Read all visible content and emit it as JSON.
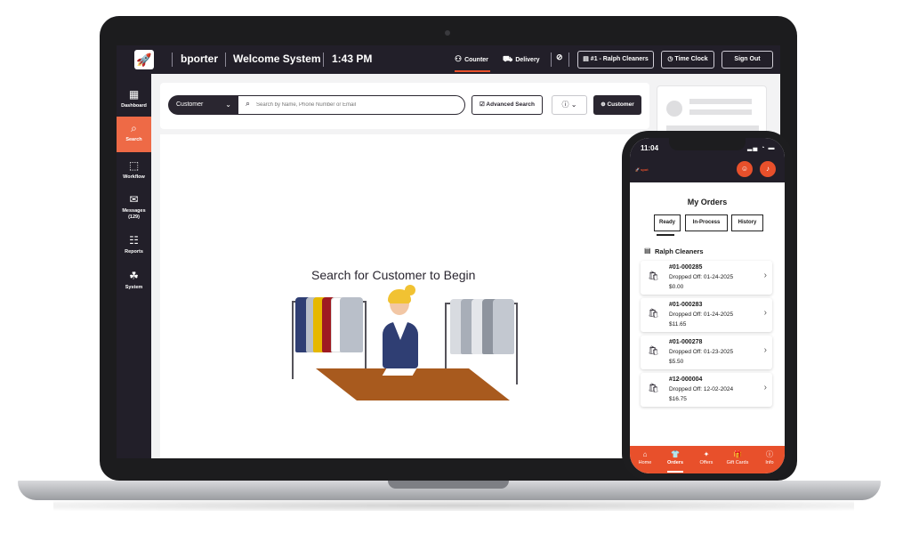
{
  "topbar": {
    "username": "bporter",
    "system_title": "Welcome System",
    "time": "1:43 PM",
    "nav": [
      {
        "label": "Counter",
        "icon": "people-icon"
      },
      {
        "label": "Delivery",
        "icon": "truck-icon"
      }
    ],
    "store_button": "#1 - Ralph Cleaners",
    "time_clock_button": "Time Clock",
    "sign_out_button": "Sign Out",
    "accent_color": "#e8502b"
  },
  "sidebar": {
    "items": [
      {
        "label": "Dashboard",
        "icon": "dashboard-icon"
      },
      {
        "label": "Search",
        "icon": "search-icon",
        "active": true
      },
      {
        "label": "Workflow",
        "icon": "workflow-icon"
      },
      {
        "label": "Messages",
        "sub": "(129)",
        "icon": "messages-icon"
      },
      {
        "label": "Reports",
        "icon": "reports-icon"
      },
      {
        "label": "System",
        "icon": "system-icon"
      }
    ]
  },
  "search": {
    "filter_value": "Customer",
    "placeholder": "Search by Name, Phone Number or Email",
    "advanced_button": "Advanced Search",
    "customer_button": "Customer"
  },
  "main": {
    "heading": "Search for Customer to Begin"
  },
  "phone": {
    "time": "11:04",
    "title": "My Orders",
    "tabs": [
      "Ready",
      "In-Process",
      "History"
    ],
    "store_name": "Ralph Cleaners",
    "orders": [
      {
        "number": "#01-000285",
        "dropped": "Dropped Off: 01-24-2025",
        "amount": "$0.00"
      },
      {
        "number": "#01-000283",
        "dropped": "Dropped Off: 01-24-2025",
        "amount": "$11.65"
      },
      {
        "number": "#01-000278",
        "dropped": "Dropped Off: 01-23-2025",
        "amount": "$5.50"
      },
      {
        "number": "#12-000004",
        "dropped": "Dropped Off: 12-02-2024",
        "amount": "$16.75"
      }
    ],
    "footer_nav": [
      {
        "label": "Home",
        "icon": "home-icon"
      },
      {
        "label": "Orders",
        "icon": "shirt-icon",
        "active": true
      },
      {
        "label": "Offers",
        "icon": "tag-icon"
      },
      {
        "label": "Gift Cards",
        "icon": "gift-icon"
      },
      {
        "label": "Info",
        "icon": "info-icon"
      }
    ]
  }
}
